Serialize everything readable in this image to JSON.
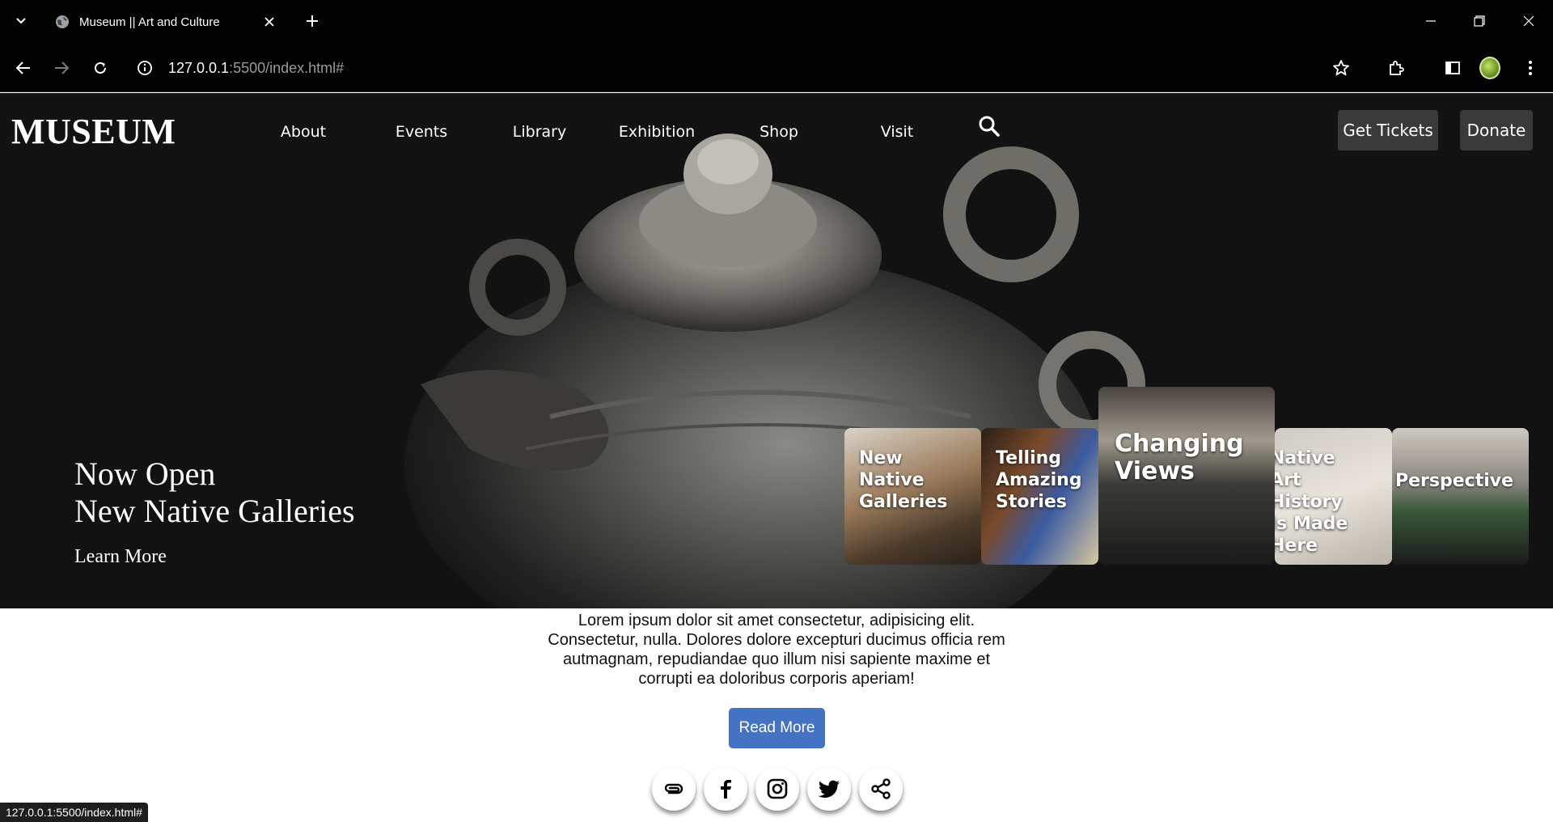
{
  "browser": {
    "tab_title": "Museum || Art and Culture",
    "url_host": "127.0.0.1",
    "url_path": ":5500/index.html#",
    "status_url": "127.0.0.1:5500/index.html#"
  },
  "site": {
    "logo": "MUSEUM",
    "nav": [
      "About",
      "Events",
      "Library",
      "Exhibition",
      "Shop",
      "Visit"
    ],
    "get_tickets": "Get Tickets",
    "donate": "Donate"
  },
  "hero": {
    "line1": "Now Open",
    "line2": "New Native Galleries",
    "learn_more": "Learn More"
  },
  "cards": [
    {
      "label_lines": [
        "New",
        "Native",
        "Galleries"
      ]
    },
    {
      "label_lines": [
        "Telling",
        "Amazing",
        "Stories"
      ]
    },
    {
      "label_lines": [
        "Changing",
        "Views"
      ]
    },
    {
      "label_lines": [
        "Native",
        "Art",
        "History",
        "Is Made",
        "Here"
      ]
    },
    {
      "label_lines": [
        "Perspective"
      ]
    }
  ],
  "content": {
    "paragraph": "Lorem ipsum dolor sit amet consectetur, adipisicing elit. Consectetur, nulla. Dolores dolore excepturi ducimus officia rem autmagnam, repudiandae quo illum nisi sapiente maxime et corrupti ea doloribus corporis aperiam!",
    "read_more": "Read More"
  },
  "socials": [
    "link-icon",
    "facebook-icon",
    "instagram-icon",
    "twitter-icon",
    "share-icon"
  ]
}
